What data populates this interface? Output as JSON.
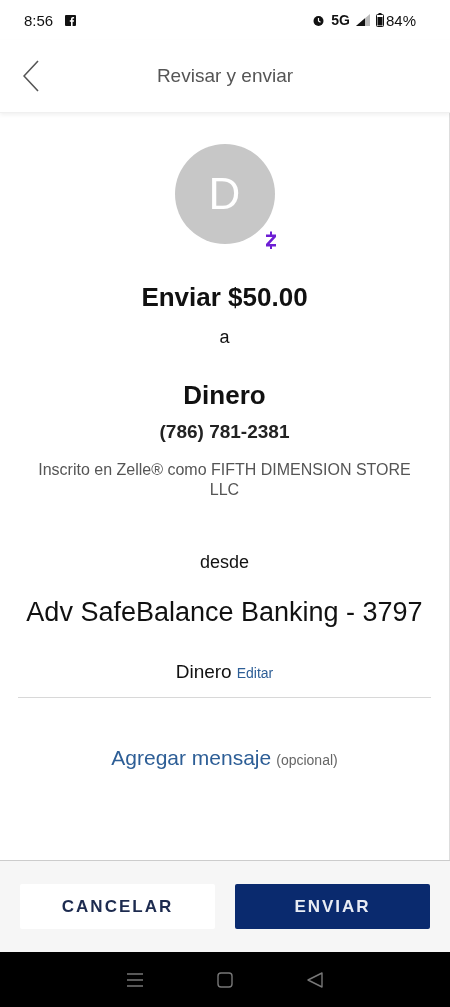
{
  "status_bar": {
    "time": "8:56",
    "network": "5G",
    "battery": "84%"
  },
  "header": {
    "title": "Revisar y enviar"
  },
  "recipient": {
    "initial": "D",
    "action": "Enviar $50.00",
    "connector": "a",
    "name": "Dinero",
    "phone": "(786) 781-2381",
    "enrolled_as": "Inscrito en Zelle® como FIFTH DIMENSION STORE LLC"
  },
  "source": {
    "connector": "desde",
    "account": "Adv SafeBalance Banking - 3797",
    "memo": "Dinero",
    "edit_link": "Editar"
  },
  "message": {
    "link": "Agregar mensaje",
    "hint": "(opcional)"
  },
  "buttons": [
    {
      "label": "CANCELAR",
      "kind": "secondary"
    },
    {
      "label": "ENVIAR",
      "kind": "primary"
    }
  ]
}
